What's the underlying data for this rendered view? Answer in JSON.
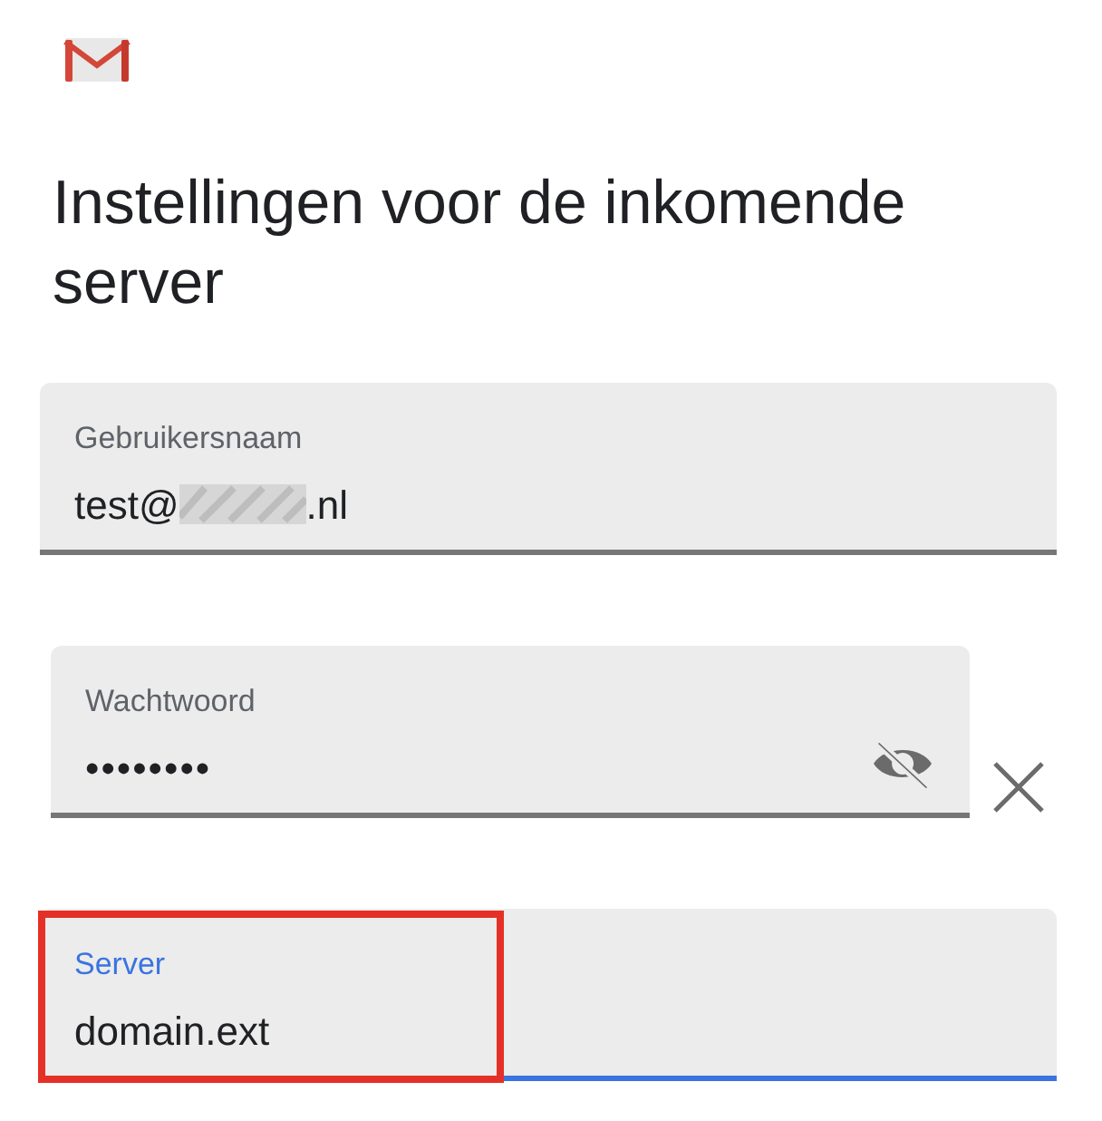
{
  "title": "Instellingen voor de inkomende server",
  "fields": [
    {
      "kind": "text",
      "label": "Gebruikersnaam",
      "value_start": "test@",
      "redacted": true,
      "value_end": ".nl",
      "focused": false,
      "highlighted": false
    },
    {
      "kind": "password",
      "label": "Wachtwoord",
      "value_start": "••••••••",
      "focused": false,
      "highlighted": false
    },
    {
      "kind": "text",
      "label": "Server",
      "value_start": "domain.ext",
      "focused": true,
      "highlighted": true
    }
  ]
}
